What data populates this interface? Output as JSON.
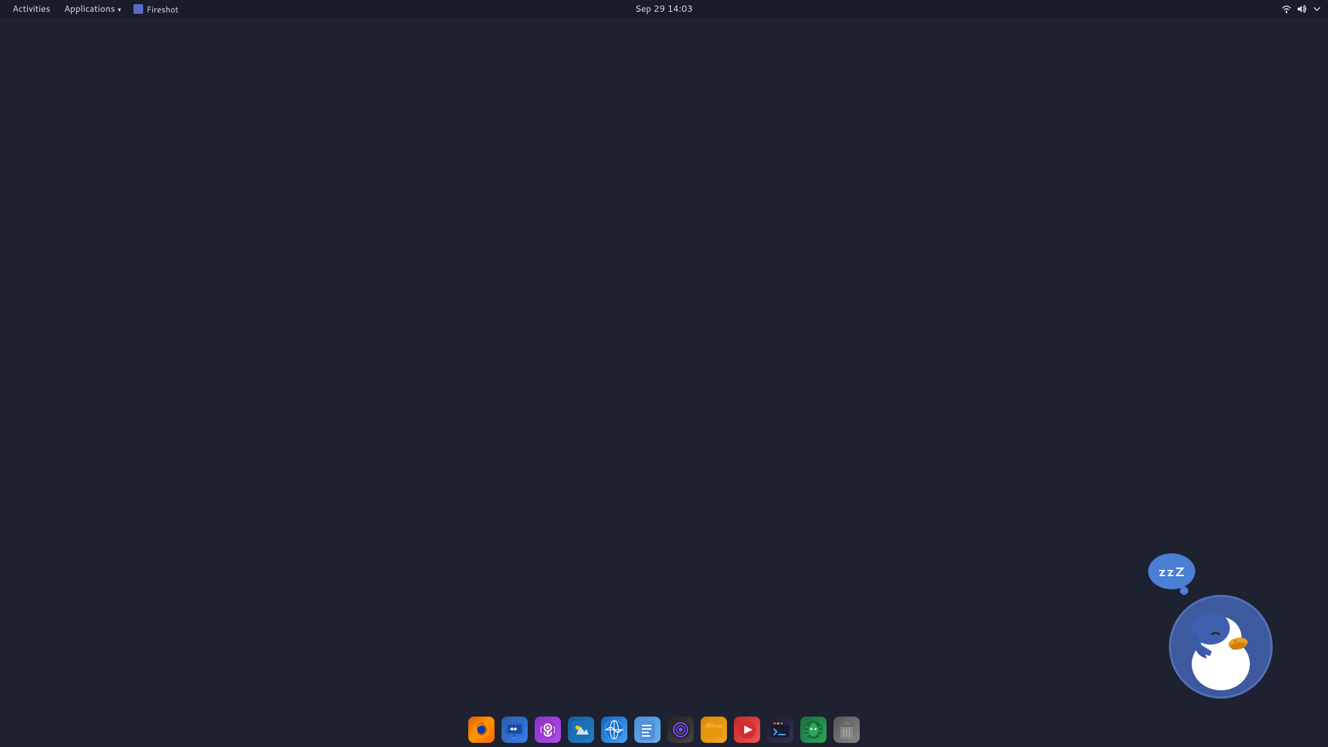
{
  "topbar": {
    "activities_label": "Activities",
    "applications_label": "Applications",
    "active_window_label": "Fireshot",
    "datetime": "Sep 29  14:03",
    "icons": {
      "wifi": "wifi-icon",
      "volume": "volume-icon",
      "chevron": "chevron-down-icon"
    }
  },
  "desktop": {
    "background_color": "#1e2130"
  },
  "mascot": {
    "zzz_text": "zzZ",
    "name": "DuckDuckGo Duck"
  },
  "dock": {
    "items": [
      {
        "id": "firefox",
        "label": "Firefox",
        "icon_class": "firefox-icon",
        "icon_char": "🦊"
      },
      {
        "id": "remdesktop",
        "label": "Remote Desktop",
        "icon_class": "remdesktop-icon",
        "icon_char": "⇄"
      },
      {
        "id": "podcast",
        "label": "Podcast",
        "icon_class": "podcast-icon",
        "icon_char": "🎙"
      },
      {
        "id": "draw",
        "label": "Draw",
        "icon_class": "draw-icon",
        "icon_char": "✏"
      },
      {
        "id": "browser",
        "label": "Web Browser",
        "icon_class": "browser-icon",
        "icon_char": "🌐"
      },
      {
        "id": "text",
        "label": "Text Editor",
        "icon_class": "text-icon",
        "icon_char": "📄"
      },
      {
        "id": "obs",
        "label": "OBS",
        "icon_class": "obs-icon",
        "icon_char": "⊙"
      },
      {
        "id": "files",
        "label": "Files",
        "icon_class": "files-icon",
        "icon_char": "📁"
      },
      {
        "id": "play",
        "label": "Media Player",
        "icon_class": "play-icon",
        "icon_char": "▶"
      },
      {
        "id": "terminal",
        "label": "Terminal",
        "icon_class": "terminal-icon",
        "icon_char": ">_"
      },
      {
        "id": "bugs",
        "label": "Bug Tracker",
        "icon_class": "bugs-icon",
        "icon_char": "🐛"
      },
      {
        "id": "trash",
        "label": "Trash",
        "icon_class": "trash-icon",
        "icon_char": "🗑"
      }
    ]
  }
}
